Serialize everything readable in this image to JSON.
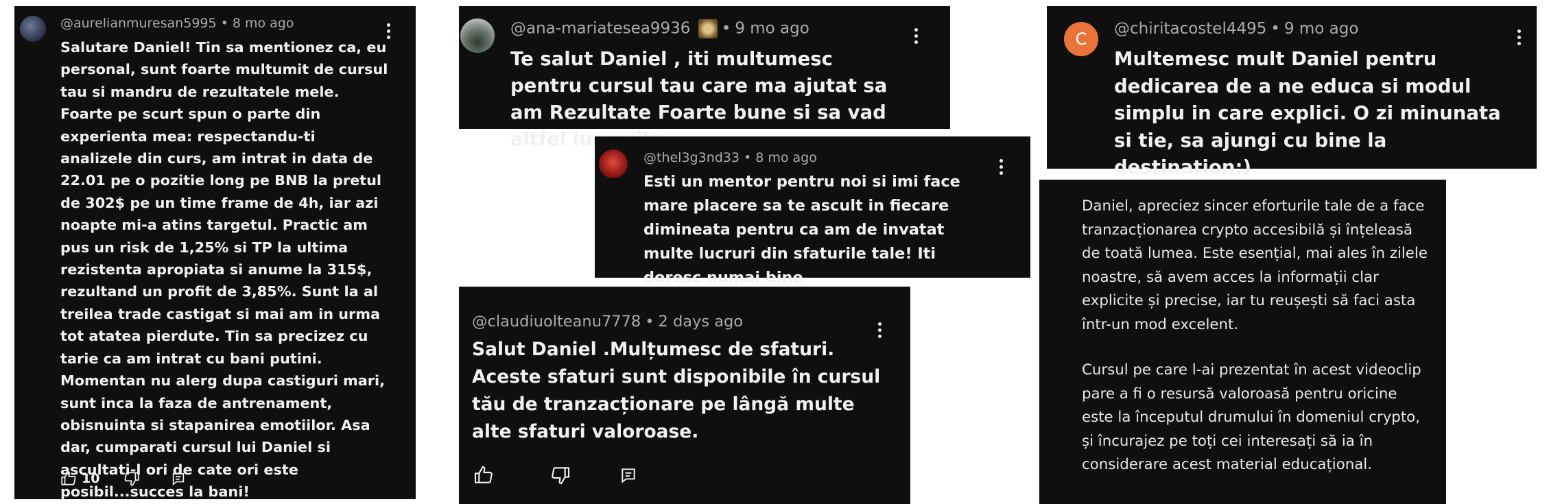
{
  "comments": [
    {
      "handle": "@aurelianmuresan5995",
      "time": "8 mo ago",
      "text": "Salutare Daniel! Tin sa mentionez ca, eu personal, sunt foarte multumit de cursul tau si mandru de rezultatele mele. Foarte pe scurt spun o parte din experienta mea: respectandu-ti analizele din curs, am intrat in data de 22.01 pe o pozitie long pe BNB la pretul de 302$ pe un time frame de 4h, iar azi noapte mi-a atins targetul. Practic am pus un risk de 1,25% si TP la ultima rezistenta apropiata si anume la 315$, rezultand un profit de 3,85%. Sunt la al treilea trade castigat si mai am in urma tot atatea pierdute. Tin sa precizez cu tarie ca am intrat cu bani putini. Momentan nu alerg dupa castiguri mari, sunt inca la faza de antrenament, obisnuinta si stapanirea emotiilor. Asa dar, cumparati cursul lui Daniel si ascultati-l ori de cate ori este posibil...succes la bani!",
      "likes": "10"
    },
    {
      "handle": "@ana-mariatesea9936",
      "time": "9 mo ago",
      "text": "Te salut Daniel ,  iti multumesc pentru cursul tau care ma ajutat sa am Rezultate Foarte bune si sa vad altfel lucrurile,"
    },
    {
      "handle": "@thel3g3nd33",
      "time": "8 mo ago",
      "text": "Esti un mentor pentru noi si imi face mare placere sa te ascult in fiecare dimineata pentru ca am de invatat multe lucruri din sfaturile tale! Iti doresc numai bine"
    },
    {
      "handle": "@claudiuolteanu7778",
      "time": "2 days ago",
      "text": "Salut Daniel .Mulțumesc de sfaturi. Aceste sfaturi sunt disponibile în cursul tău de tranzacționare pe lângă multe alte sfaturi valoroase."
    },
    {
      "handle": "@chiritacostel4495",
      "time": "9 mo ago",
      "avatar_letter": "C",
      "text": "Multemesc mult Daniel pentru dedicarea de a ne educa si modul simplu in care explici. O zi minunata si tie, sa ajungi cu bine la destination:)"
    },
    {
      "paragraph1": "Daniel, apreciez sincer eforturile tale de a face tranzacționarea crypto accesibilă și înțeleasă de toată lumea. Este esențial, mai ales în zilele noastre, să avem acces la informații clar explicite și precise, iar tu reușești să faci asta într-un mod excelent.",
      "paragraph2": "Cursul pe care l-ai prezentat în acest videoclip pare a fi o resursă valoroasă pentru oricine este la începutul drumului în domeniul crypto, și încurajez pe toți cei interesați să ia în considerare acest material educațional."
    }
  ],
  "dot": "•",
  "colors": {
    "card_bg": "#0f0f0f",
    "text": "#f1f1f1",
    "meta": "#aaaaaa",
    "avatar_orange": "#e8743b"
  },
  "icons": [
    "like-icon",
    "dislike-icon",
    "reply-icon",
    "more-icon"
  ]
}
